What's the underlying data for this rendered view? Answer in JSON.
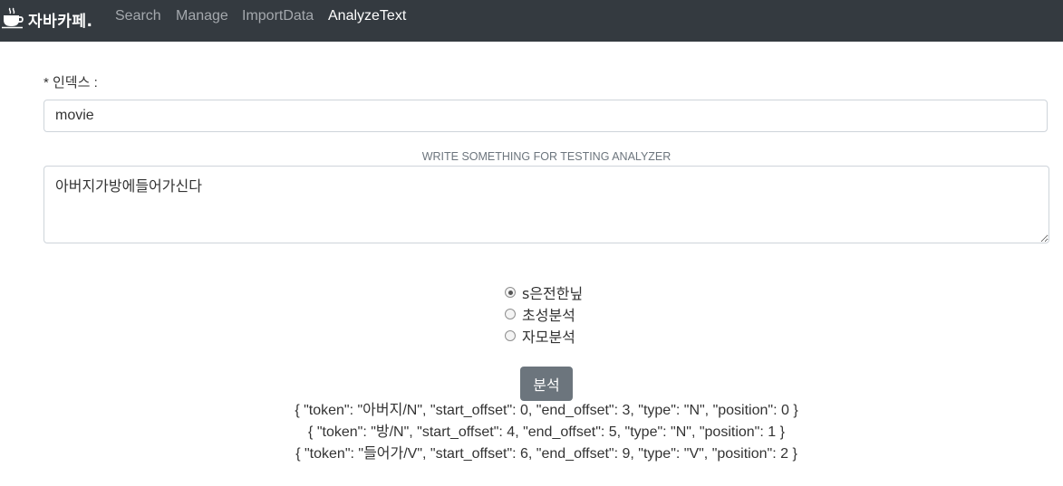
{
  "navbar": {
    "brand": {
      "logo_icon": "coffee-cup-icon",
      "text": "자바카페."
    },
    "links": [
      {
        "label": "Search",
        "active": false
      },
      {
        "label": "Manage",
        "active": false
      },
      {
        "label": "ImportData",
        "active": false
      },
      {
        "label": "AnalyzeText",
        "active": true
      }
    ],
    "bg_color": "#343a40"
  },
  "form": {
    "index_label": "* 인덱스 :",
    "index_value": "movie",
    "textarea_caption": "WRITE SOMETHING FOR TESTING ANALYZER",
    "textarea_value": "아버지가방에들어가신다",
    "radio_options": [
      {
        "label": "s은전한닢",
        "checked": true
      },
      {
        "label": "초성분석",
        "checked": false
      },
      {
        "label": "자모분석",
        "checked": false
      }
    ],
    "analyze_button": "분석"
  },
  "results": [
    "{ \"token\": \"아버지/N\", \"start_offset\": 0, \"end_offset\": 3, \"type\": \"N\", \"position\": 0 }",
    "{ \"token\": \"방/N\", \"start_offset\": 4, \"end_offset\": 5, \"type\": \"N\", \"position\": 1 }",
    "{ \"token\": \"들어가/V\", \"start_offset\": 6, \"end_offset\": 9, \"type\": \"V\", \"position\": 2 }"
  ]
}
